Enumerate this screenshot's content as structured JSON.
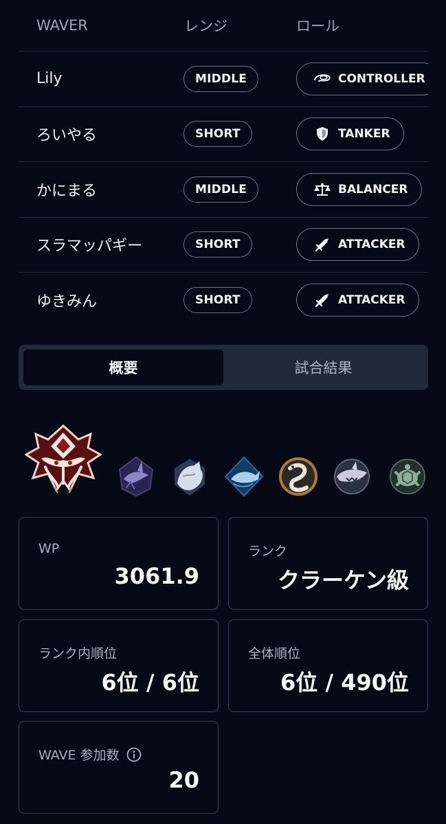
{
  "table": {
    "headers": {
      "name": "WAVER",
      "range": "レンジ",
      "role": "ロール"
    },
    "rows": [
      {
        "name": "Lily",
        "range": "MIDDLE",
        "role": "CONTROLLER",
        "role_icon": "controller-icon"
      },
      {
        "name": "ろいやる",
        "range": "SHORT",
        "role": "TANKER",
        "role_icon": "shield-icon"
      },
      {
        "name": "かにまる",
        "range": "MIDDLE",
        "role": "BALANCER",
        "role_icon": "scales-icon"
      },
      {
        "name": "スラマッパギー",
        "range": "SHORT",
        "role": "ATTACKER",
        "role_icon": "sword-icon"
      },
      {
        "name": "ゆきみん",
        "range": "SHORT",
        "role": "ATTACKER",
        "role_icon": "sword-icon"
      }
    ]
  },
  "tabs": [
    {
      "label": "概要",
      "active": true
    },
    {
      "label": "試合結果",
      "active": false
    }
  ],
  "badges": [
    {
      "icon": "kraken-rank-emblem-icon",
      "highlighted": true
    },
    {
      "icon": "purple-shark-emblem-icon"
    },
    {
      "icon": "white-wolf-emblem-icon"
    },
    {
      "icon": "blue-whale-emblem-icon"
    },
    {
      "icon": "eel-emblem-icon"
    },
    {
      "icon": "grey-shark-emblem-icon"
    },
    {
      "icon": "turtle-emblem-icon"
    }
  ],
  "stats": {
    "wp": {
      "label": "WP",
      "value": "3061.9"
    },
    "rank": {
      "label": "ランク",
      "value": "クラーケン級"
    },
    "rank_position": {
      "label": "ランク内順位",
      "value": "6位 / 6位"
    },
    "overall_position": {
      "label": "全体順位",
      "value": "6位 / 490位"
    },
    "wave_count": {
      "label": "WAVE 参加数",
      "value": "20"
    }
  },
  "colors": {
    "background": "#060a16",
    "border": "#3a4152",
    "tab_bg": "#222a39",
    "text_primary": "#f5f6fa",
    "text_secondary": "#a9b0c0"
  }
}
